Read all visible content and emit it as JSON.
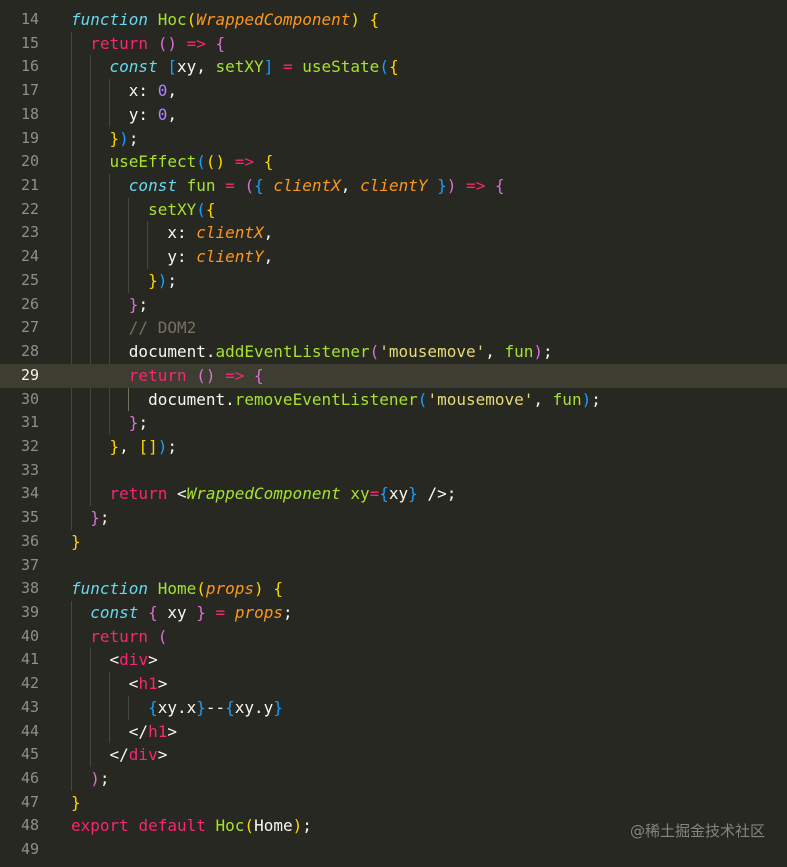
{
  "editor": {
    "current_line": 29,
    "lines": [
      {
        "num": "14",
        "tokens": [
          [
            "k",
            "function"
          ],
          [
            "w",
            " "
          ],
          [
            "f",
            "Hoc"
          ],
          [
            "b1",
            "("
          ],
          [
            "p",
            "WrappedComponent"
          ],
          [
            "b1",
            ")"
          ],
          [
            "w",
            " "
          ],
          [
            "b1",
            "{"
          ]
        ]
      },
      {
        "num": "15",
        "tokens": [
          [
            "w",
            "  "
          ],
          [
            "r",
            "return"
          ],
          [
            "w",
            " "
          ],
          [
            "b2",
            "()"
          ],
          [
            "w",
            " "
          ],
          [
            "o",
            "=>"
          ],
          [
            "w",
            " "
          ],
          [
            "b2",
            "{"
          ]
        ]
      },
      {
        "num": "16",
        "tokens": [
          [
            "w",
            "    "
          ],
          [
            "k",
            "const"
          ],
          [
            "w",
            " "
          ],
          [
            "b3",
            "["
          ],
          [
            "w",
            "xy, "
          ],
          [
            "f",
            "setXY"
          ],
          [
            "b3",
            "]"
          ],
          [
            "w",
            " "
          ],
          [
            "o",
            "="
          ],
          [
            "w",
            " "
          ],
          [
            "f",
            "useState"
          ],
          [
            "b3",
            "("
          ],
          [
            "b1",
            "{"
          ]
        ]
      },
      {
        "num": "17",
        "tokens": [
          [
            "w",
            "      x: "
          ],
          [
            "n",
            "0"
          ],
          [
            "w",
            ","
          ]
        ]
      },
      {
        "num": "18",
        "tokens": [
          [
            "w",
            "      y: "
          ],
          [
            "n",
            "0"
          ],
          [
            "w",
            ","
          ]
        ]
      },
      {
        "num": "19",
        "tokens": [
          [
            "w",
            "    "
          ],
          [
            "b1",
            "}"
          ],
          [
            "b3",
            ")"
          ],
          [
            "w",
            ";"
          ]
        ]
      },
      {
        "num": "20",
        "tokens": [
          [
            "w",
            "    "
          ],
          [
            "f",
            "useEffect"
          ],
          [
            "b3",
            "("
          ],
          [
            "b1",
            "()"
          ],
          [
            "w",
            " "
          ],
          [
            "o",
            "=>"
          ],
          [
            "w",
            " "
          ],
          [
            "b1",
            "{"
          ]
        ]
      },
      {
        "num": "21",
        "tokens": [
          [
            "w",
            "      "
          ],
          [
            "k",
            "const"
          ],
          [
            "w",
            " "
          ],
          [
            "f",
            "fun"
          ],
          [
            "w",
            " "
          ],
          [
            "o",
            "="
          ],
          [
            "w",
            " "
          ],
          [
            "b2",
            "("
          ],
          [
            "b3",
            "{"
          ],
          [
            "w",
            " "
          ],
          [
            "p",
            "clientX"
          ],
          [
            "w",
            ", "
          ],
          [
            "p",
            "clientY"
          ],
          [
            "w",
            " "
          ],
          [
            "b3",
            "}"
          ],
          [
            "b2",
            ")"
          ],
          [
            "w",
            " "
          ],
          [
            "o",
            "=>"
          ],
          [
            "w",
            " "
          ],
          [
            "b2",
            "{"
          ]
        ]
      },
      {
        "num": "22",
        "tokens": [
          [
            "w",
            "        "
          ],
          [
            "f",
            "setXY"
          ],
          [
            "b3",
            "("
          ],
          [
            "b1",
            "{"
          ]
        ]
      },
      {
        "num": "23",
        "tokens": [
          [
            "w",
            "          x: "
          ],
          [
            "p",
            "clientX"
          ],
          [
            "w",
            ","
          ]
        ]
      },
      {
        "num": "24",
        "tokens": [
          [
            "w",
            "          y: "
          ],
          [
            "p",
            "clientY"
          ],
          [
            "w",
            ","
          ]
        ]
      },
      {
        "num": "25",
        "tokens": [
          [
            "w",
            "        "
          ],
          [
            "b1",
            "}"
          ],
          [
            "b3",
            ")"
          ],
          [
            "w",
            ";"
          ]
        ]
      },
      {
        "num": "26",
        "tokens": [
          [
            "w",
            "      "
          ],
          [
            "b2",
            "}"
          ],
          [
            "w",
            ";"
          ]
        ]
      },
      {
        "num": "27",
        "tokens": [
          [
            "w",
            "      "
          ],
          [
            "cm",
            "// DOM2"
          ]
        ]
      },
      {
        "num": "28",
        "tokens": [
          [
            "w",
            "      document."
          ],
          [
            "f",
            "addEventListener"
          ],
          [
            "b2",
            "("
          ],
          [
            "s",
            "'mousemove'"
          ],
          [
            "w",
            ", "
          ],
          [
            "f",
            "fun"
          ],
          [
            "b2",
            ")"
          ],
          [
            "w",
            ";"
          ]
        ]
      },
      {
        "num": "29",
        "tokens": [
          [
            "w",
            "      "
          ],
          [
            "r",
            "return"
          ],
          [
            "w",
            " "
          ],
          [
            "b2",
            "()"
          ],
          [
            "w",
            " "
          ],
          [
            "o",
            "=>"
          ],
          [
            "w",
            " "
          ],
          [
            "b2",
            "{"
          ]
        ]
      },
      {
        "num": "30",
        "tokens": [
          [
            "w",
            "        document."
          ],
          [
            "f",
            "removeEventListener"
          ],
          [
            "b3",
            "("
          ],
          [
            "s",
            "'mousemove'"
          ],
          [
            "w",
            ", "
          ],
          [
            "f",
            "fun"
          ],
          [
            "b3",
            ")"
          ],
          [
            "w",
            ";"
          ]
        ]
      },
      {
        "num": "31",
        "tokens": [
          [
            "w",
            "      "
          ],
          [
            "b2",
            "}"
          ],
          [
            "w",
            ";"
          ]
        ]
      },
      {
        "num": "32",
        "tokens": [
          [
            "w",
            "    "
          ],
          [
            "b1",
            "}"
          ],
          [
            "w",
            ", "
          ],
          [
            "b1",
            "[]"
          ],
          [
            "b3",
            ")"
          ],
          [
            "w",
            ";"
          ]
        ]
      },
      {
        "num": "33",
        "tokens": []
      },
      {
        "num": "34",
        "tokens": [
          [
            "w",
            "    "
          ],
          [
            "r",
            "return"
          ],
          [
            "w",
            " <"
          ],
          [
            "c",
            "WrappedComponent"
          ],
          [
            "w",
            " "
          ],
          [
            "f",
            "xy"
          ],
          [
            "o",
            "="
          ],
          [
            "b3",
            "{"
          ],
          [
            "w",
            "xy"
          ],
          [
            "b3",
            "}"
          ],
          [
            "w",
            " />;"
          ]
        ]
      },
      {
        "num": "35",
        "tokens": [
          [
            "w",
            "  "
          ],
          [
            "b2",
            "}"
          ],
          [
            "w",
            ";"
          ]
        ]
      },
      {
        "num": "36",
        "tokens": [
          [
            "b1",
            "}"
          ]
        ]
      },
      {
        "num": "37",
        "tokens": []
      },
      {
        "num": "38",
        "tokens": [
          [
            "k",
            "function"
          ],
          [
            "w",
            " "
          ],
          [
            "f",
            "Home"
          ],
          [
            "b1",
            "("
          ],
          [
            "p",
            "props"
          ],
          [
            "b1",
            ")"
          ],
          [
            "w",
            " "
          ],
          [
            "b1",
            "{"
          ]
        ]
      },
      {
        "num": "39",
        "tokens": [
          [
            "w",
            "  "
          ],
          [
            "k",
            "const"
          ],
          [
            "w",
            " "
          ],
          [
            "b2",
            "{"
          ],
          [
            "w",
            " xy "
          ],
          [
            "b2",
            "}"
          ],
          [
            "w",
            " "
          ],
          [
            "o",
            "="
          ],
          [
            "w",
            " "
          ],
          [
            "p",
            "props"
          ],
          [
            "w",
            ";"
          ]
        ]
      },
      {
        "num": "40",
        "tokens": [
          [
            "w",
            "  "
          ],
          [
            "r",
            "return"
          ],
          [
            "w",
            " "
          ],
          [
            "b2",
            "("
          ]
        ]
      },
      {
        "num": "41",
        "tokens": [
          [
            "w",
            "    <"
          ],
          [
            "tag",
            "div"
          ],
          [
            "w",
            ">"
          ]
        ]
      },
      {
        "num": "42",
        "tokens": [
          [
            "w",
            "      <"
          ],
          [
            "tag",
            "h1"
          ],
          [
            "w",
            ">"
          ]
        ]
      },
      {
        "num": "43",
        "tokens": [
          [
            "w",
            "        "
          ],
          [
            "b3",
            "{"
          ],
          [
            "w",
            "xy.x"
          ],
          [
            "b3",
            "}"
          ],
          [
            "w",
            "--"
          ],
          [
            "b3",
            "{"
          ],
          [
            "w",
            "xy.y"
          ],
          [
            "b3",
            "}"
          ]
        ]
      },
      {
        "num": "44",
        "tokens": [
          [
            "w",
            "      </"
          ],
          [
            "tag",
            "h1"
          ],
          [
            "w",
            ">"
          ]
        ]
      },
      {
        "num": "45",
        "tokens": [
          [
            "w",
            "    </"
          ],
          [
            "tag",
            "div"
          ],
          [
            "w",
            ">"
          ]
        ]
      },
      {
        "num": "46",
        "tokens": [
          [
            "w",
            "  "
          ],
          [
            "b2",
            ")"
          ],
          [
            "w",
            ";"
          ]
        ]
      },
      {
        "num": "47",
        "tokens": [
          [
            "b1",
            "}"
          ]
        ]
      },
      {
        "num": "48",
        "tokens": [
          [
            "r",
            "export"
          ],
          [
            "w",
            " "
          ],
          [
            "r",
            "default"
          ],
          [
            "w",
            " "
          ],
          [
            "f",
            "Hoc"
          ],
          [
            "b1",
            "("
          ],
          [
            "w",
            "Home"
          ],
          [
            "b1",
            ")"
          ],
          [
            "w",
            ";"
          ]
        ]
      },
      {
        "num": "49",
        "tokens": []
      }
    ]
  },
  "watermark": "@稀土掘金技术社区"
}
